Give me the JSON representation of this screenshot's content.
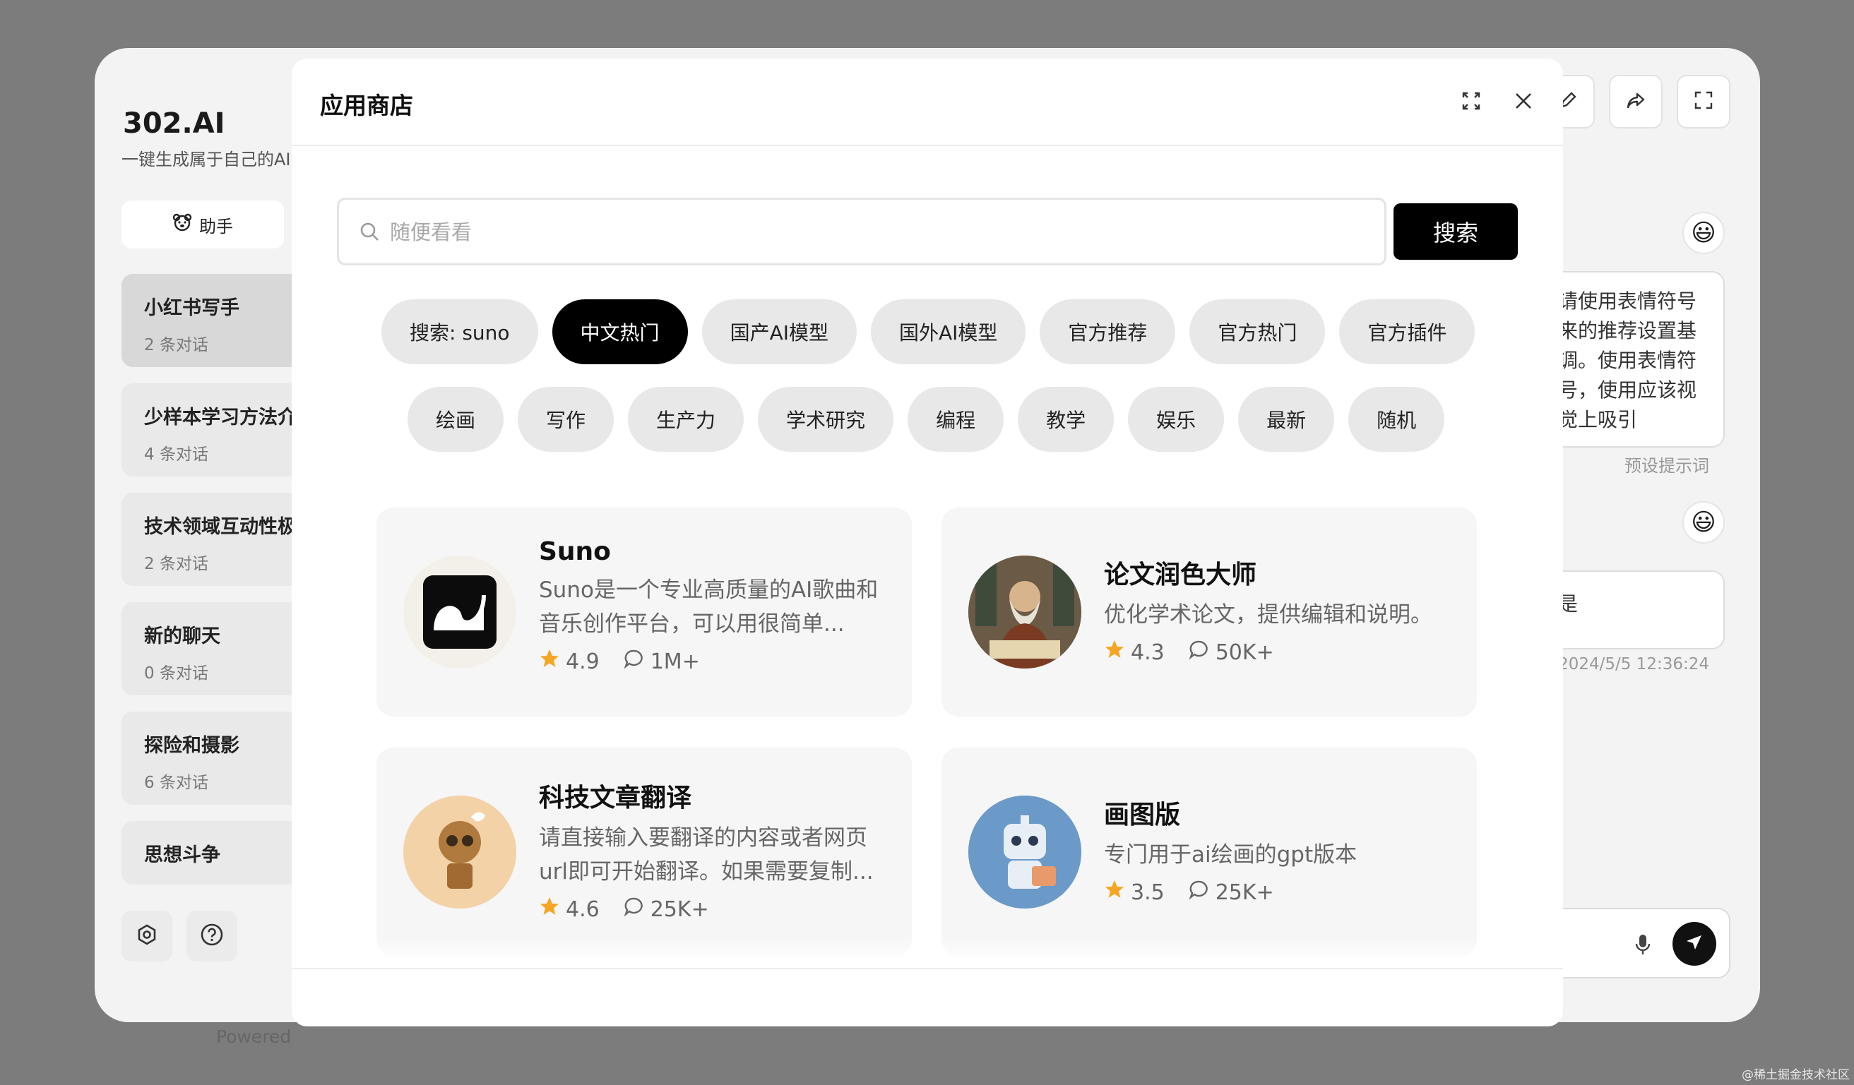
{
  "background_app": {
    "brand": "302.AI",
    "brand_subtitle": "一键生成属于自己的AI",
    "assistant_button": "助手",
    "chats": [
      {
        "title": "小红书写手",
        "count": "2 条对话"
      },
      {
        "title": "少样本学习方法介",
        "count": "4 条对话"
      },
      {
        "title": "技术领域互动性极",
        "count": "2 条对话"
      },
      {
        "title": "新的聊天",
        "count": "0 条对话"
      },
      {
        "title": "探险和摄影",
        "count": "6 条对话"
      },
      {
        "title": "思想斗争",
        "count": ""
      }
    ],
    "powered": "Powered",
    "prompt_text": "请使用表情符号来的推荐设置基调。使用表情符号，使用应该视觉上吸引",
    "prompt_label": "预设提示词",
    "message_text": "是",
    "message_time": "2024/5/5 12:36:24",
    "watermark": "@稀土掘金技术社区"
  },
  "modal": {
    "title": "应用商店",
    "search": {
      "placeholder": "随便看看",
      "value": "",
      "button": "搜索"
    },
    "tags_row1": [
      "搜索: suno",
      "中文热门",
      "国产AI模型",
      "国外AI模型",
      "官方推荐",
      "官方热门",
      "官方插件"
    ],
    "tags_row2": [
      "绘画",
      "写作",
      "生产力",
      "学术研究",
      "编程",
      "教学",
      "娱乐",
      "最新",
      "随机"
    ],
    "active_tag": "中文热门",
    "apps": [
      {
        "name": "Suno",
        "desc": "Suno是一个专业高质量的AI歌曲和音乐创作平台，可以用很简单...",
        "rating": "4.9",
        "chats": "1M+"
      },
      {
        "name": "论文润色大师",
        "desc": "优化学术论文，提供编辑和说明。",
        "rating": "4.3",
        "chats": "50K+"
      },
      {
        "name": "科技文章翻译",
        "desc": "请直接输入要翻译的内容或者网页url即可开始翻译。如果需要复制...",
        "rating": "4.6",
        "chats": "25K+"
      },
      {
        "name": "画图版",
        "desc": "专门用于ai绘画的gpt版本",
        "rating": "3.5",
        "chats": "25K+"
      }
    ]
  },
  "colors": {
    "accent": "#000000",
    "star": "#f5a623",
    "tag_bg": "#e8e8e8"
  }
}
